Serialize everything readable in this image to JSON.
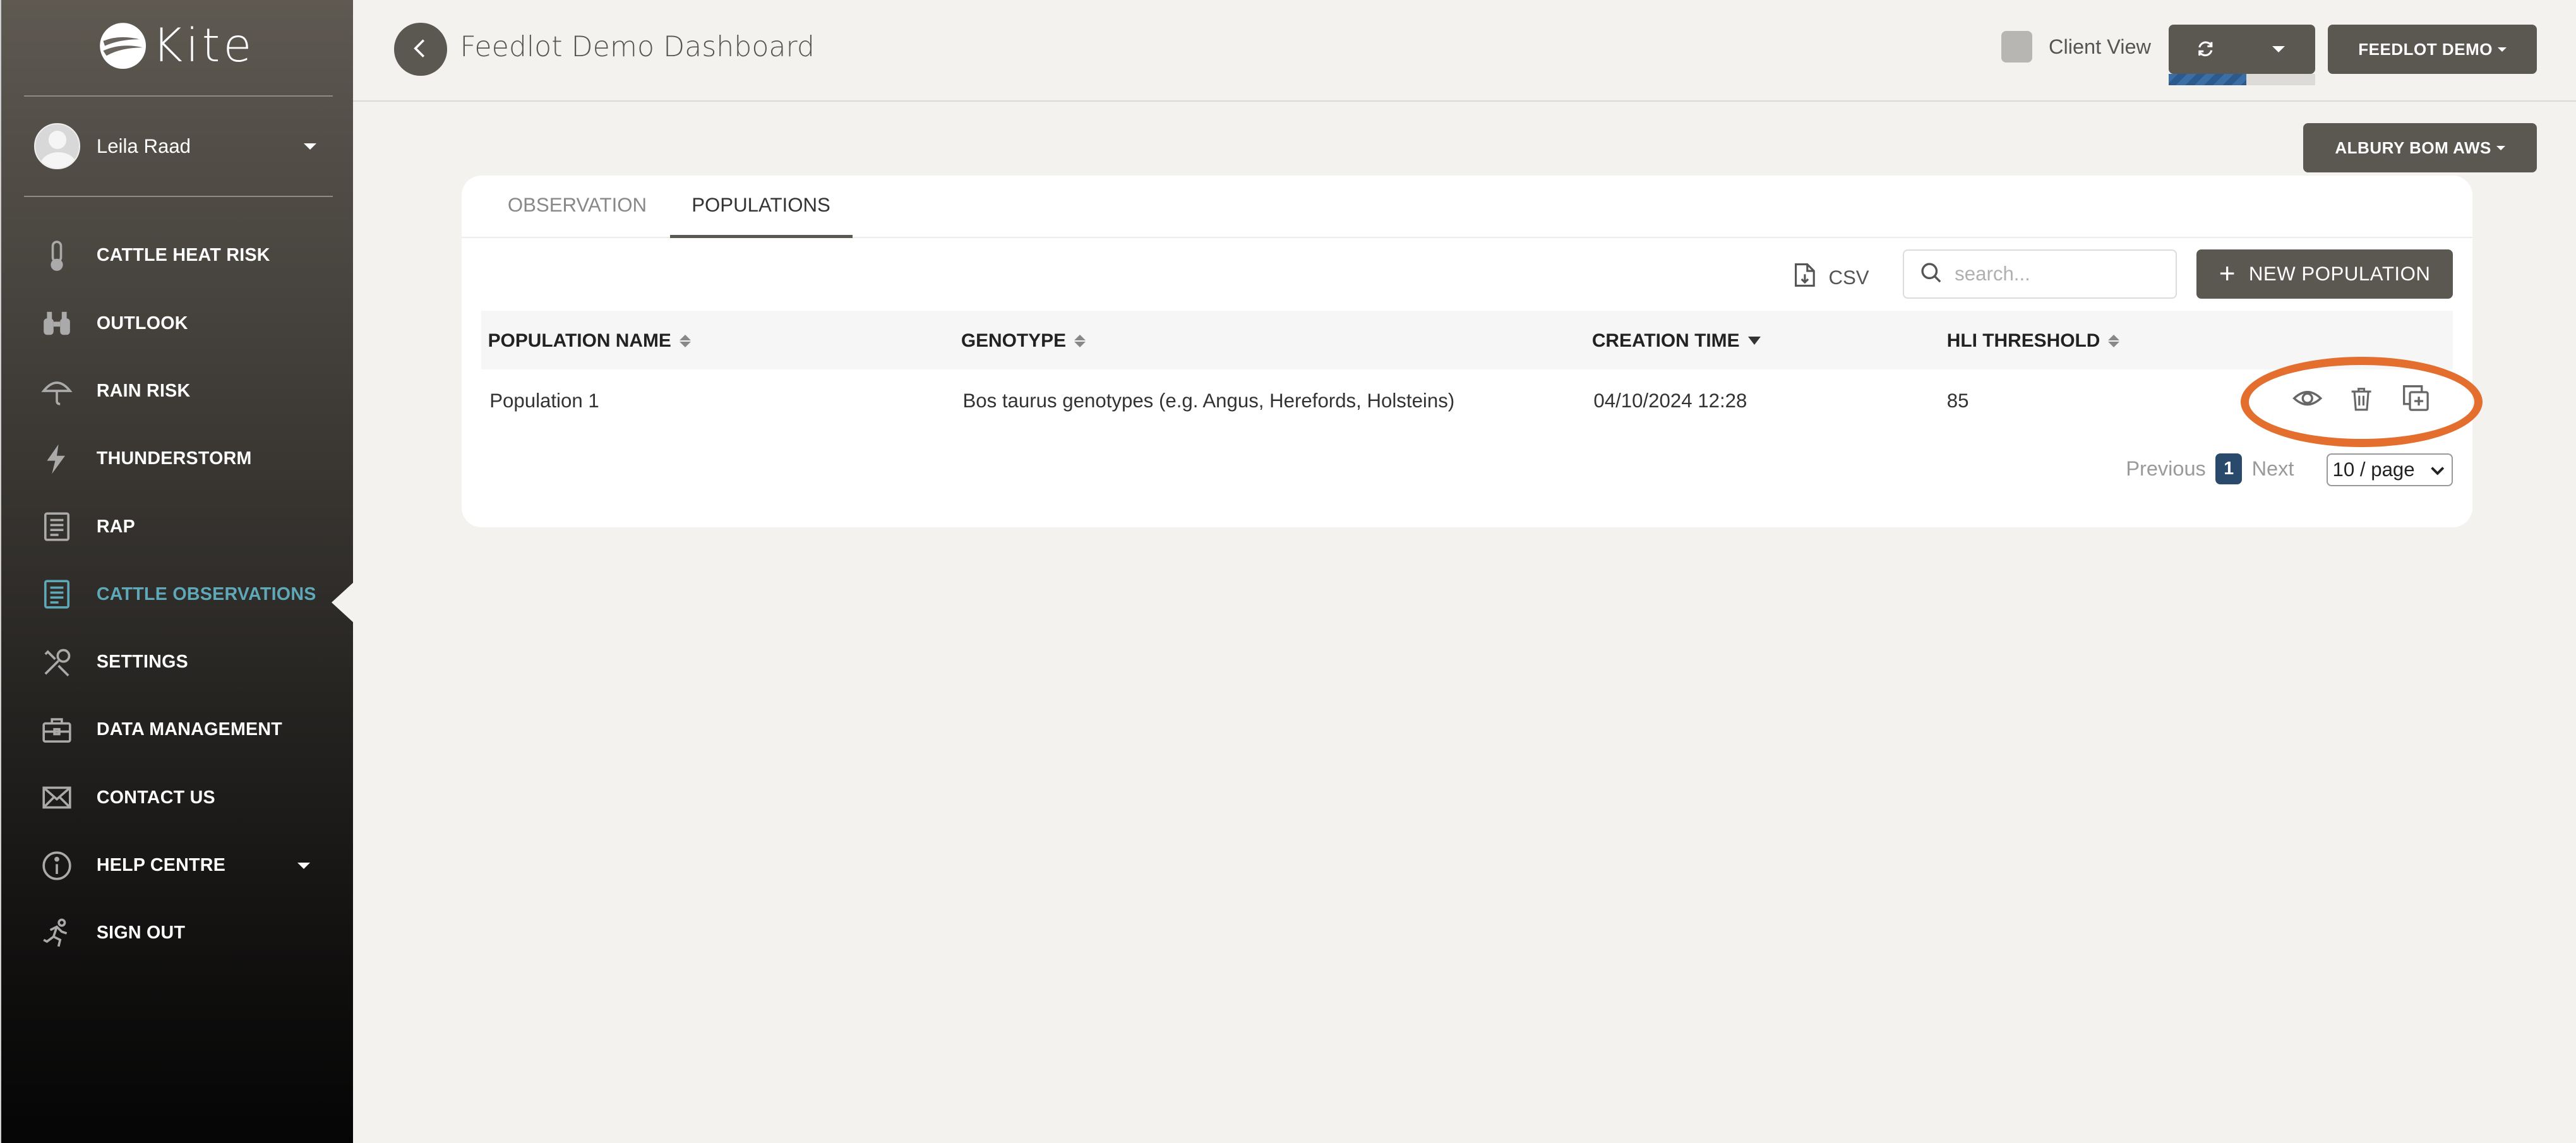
{
  "app": {
    "logo_text": "Kite"
  },
  "user": {
    "name": "Leila Raad"
  },
  "sidebar": {
    "items": [
      {
        "label": "CATTLE HEAT RISK",
        "icon": "thermometer-icon"
      },
      {
        "label": "OUTLOOK",
        "icon": "binoculars-icon"
      },
      {
        "label": "RAIN RISK",
        "icon": "umbrella-icon"
      },
      {
        "label": "THUNDERSTORM",
        "icon": "lightning-icon"
      },
      {
        "label": "RAP",
        "icon": "document-icon"
      },
      {
        "label": "CATTLE OBSERVATIONS",
        "icon": "document-icon",
        "active": true
      },
      {
        "label": "SETTINGS",
        "icon": "tools-icon"
      },
      {
        "label": "DATA MANAGEMENT",
        "icon": "briefcase-icon"
      },
      {
        "label": "CONTACT US",
        "icon": "envelope-icon"
      },
      {
        "label": "HELP CENTRE",
        "icon": "info-icon",
        "has_dropdown": true
      },
      {
        "label": "SIGN OUT",
        "icon": "running-person-icon"
      }
    ],
    "active_color": "#5fa8b8"
  },
  "header": {
    "title": "Feedlot Demo Dashboard",
    "client_view_label": "Client View",
    "client_view_checked": false,
    "refresh_progress": 0.53,
    "account_button": "FEEDLOT DEMO",
    "station_button": "ALBURY BOM AWS"
  },
  "tabs": [
    {
      "label": "OBSERVATION",
      "active": false
    },
    {
      "label": "POPULATIONS",
      "active": true
    }
  ],
  "toolbar": {
    "csv_label": "CSV",
    "search_placeholder": "search...",
    "new_button_label": "NEW POPULATION"
  },
  "table": {
    "columns": [
      {
        "label": "POPULATION NAME",
        "sort": "none"
      },
      {
        "label": "GENOTYPE",
        "sort": "none"
      },
      {
        "label": "CREATION TIME",
        "sort": "desc"
      },
      {
        "label": "HLI THRESHOLD",
        "sort": "none"
      }
    ],
    "rows": [
      {
        "name": "Population 1",
        "genotype": "Bos taurus genotypes (e.g. Angus, Herefords, Holsteins)",
        "created": "04/10/2024 12:28",
        "hli_threshold": "85",
        "actions": [
          "eye-icon",
          "trash-icon",
          "copy-icon"
        ]
      }
    ]
  },
  "pagination": {
    "previous_label": "Previous",
    "current_page": "1",
    "next_label": "Next",
    "page_size": "10 / page"
  },
  "colors": {
    "primary_button": "#5b5751",
    "highlight": "#e46e2e",
    "page_number": "#2a4a6b"
  }
}
